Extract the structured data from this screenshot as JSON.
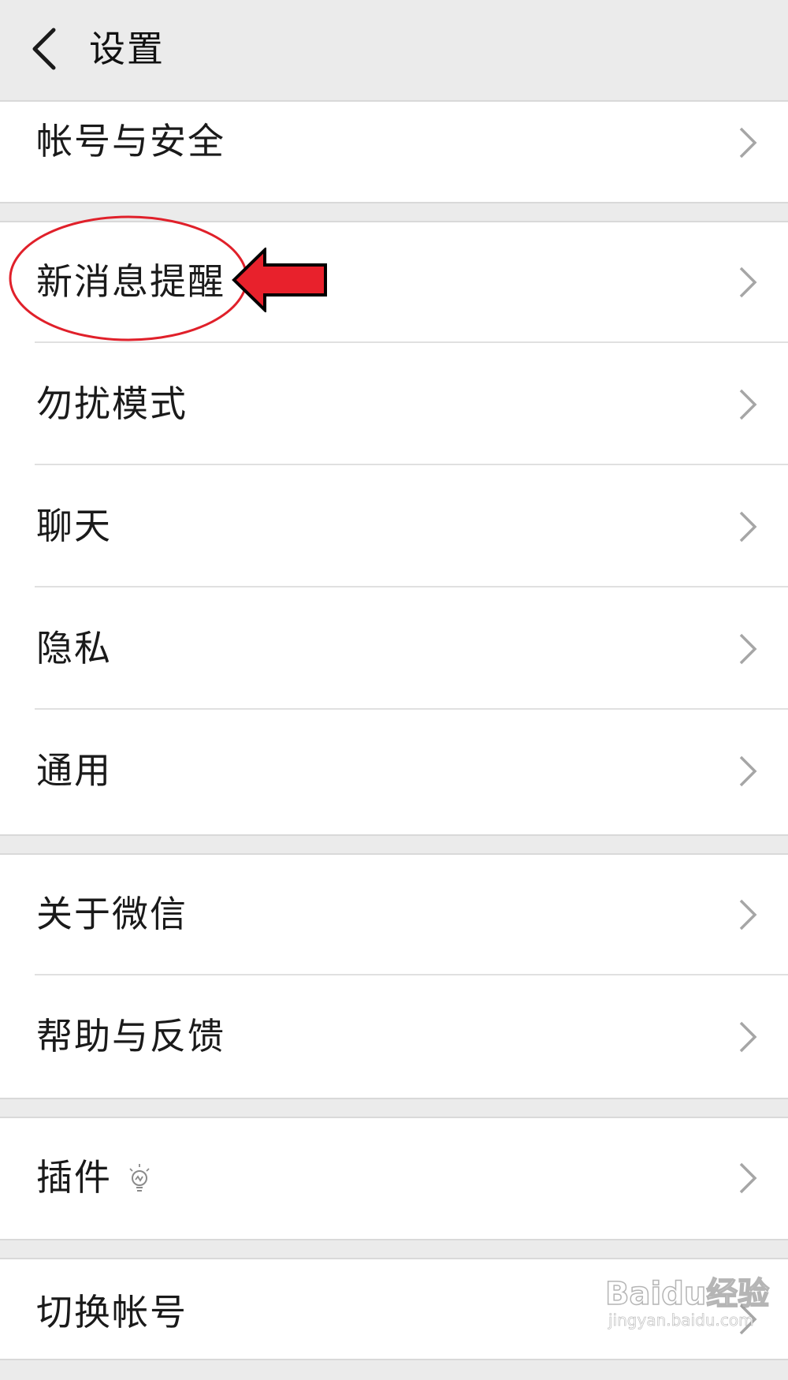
{
  "header": {
    "title": "设置",
    "back_icon": "chevron-left-icon"
  },
  "groups": [
    {
      "items": [
        {
          "label": "帐号与安全",
          "icon": "chevron-right-icon"
        }
      ]
    },
    {
      "items": [
        {
          "label": "新消息提醒",
          "icon": "chevron-right-icon",
          "highlighted": true
        },
        {
          "label": "勿扰模式",
          "icon": "chevron-right-icon"
        },
        {
          "label": "聊天",
          "icon": "chevron-right-icon"
        },
        {
          "label": "隐私",
          "icon": "chevron-right-icon"
        },
        {
          "label": "通用",
          "icon": "chevron-right-icon"
        }
      ]
    },
    {
      "items": [
        {
          "label": "关于微信",
          "icon": "chevron-right-icon"
        },
        {
          "label": "帮助与反馈",
          "icon": "chevron-right-icon"
        }
      ]
    },
    {
      "items": [
        {
          "label": "插件",
          "icon": "chevron-right-icon",
          "badge_icon": "lightbulb-icon"
        }
      ]
    },
    {
      "items": [
        {
          "label": "切换帐号",
          "icon": "chevron-right-icon"
        }
      ]
    }
  ],
  "annotation": {
    "ellipse_color": "#e0202a",
    "arrow_color": "#e8212c"
  },
  "watermark": {
    "logo": "Baidu经验",
    "url": "jingyan.baidu.com"
  }
}
